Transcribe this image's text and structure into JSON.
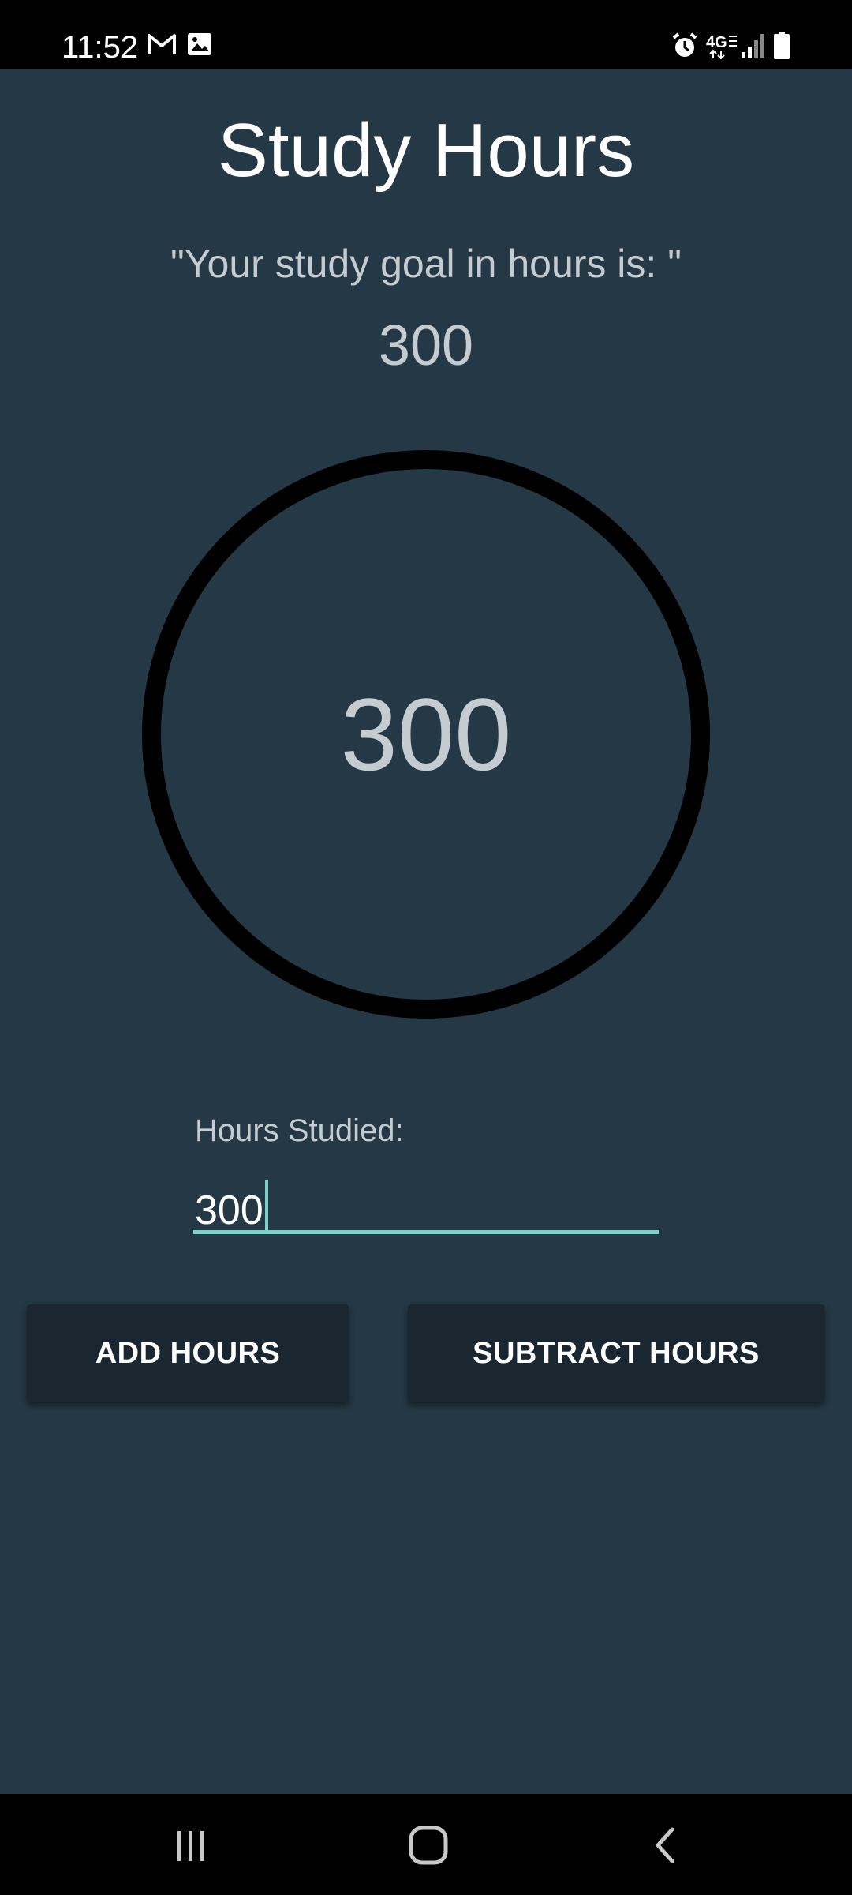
{
  "status_bar": {
    "time": "11:52",
    "left_icons": [
      "gmail-icon",
      "image-icon"
    ],
    "right_icons": [
      "alarm-icon",
      "4g-lte-icon",
      "signal-icon",
      "battery-icon"
    ],
    "network_label": "4G"
  },
  "app": {
    "title": "Study Hours",
    "goal_label": "\"Your study goal in hours is: \"",
    "goal_value": "300",
    "progress": {
      "value_text": "300",
      "ring_color": "#000000"
    },
    "hours_field": {
      "label": "Hours Studied:",
      "value": "300"
    },
    "buttons": {
      "add": "ADD HOURS",
      "subtract": "SUBTRACT HOURS"
    }
  },
  "nav_bar": {
    "items": [
      "recent-apps-icon",
      "home-icon",
      "back-icon"
    ]
  },
  "colors": {
    "background": "#243845",
    "accent": "#7fcfc8",
    "button": "#1a2731",
    "text_muted": "#c5ccd1"
  }
}
